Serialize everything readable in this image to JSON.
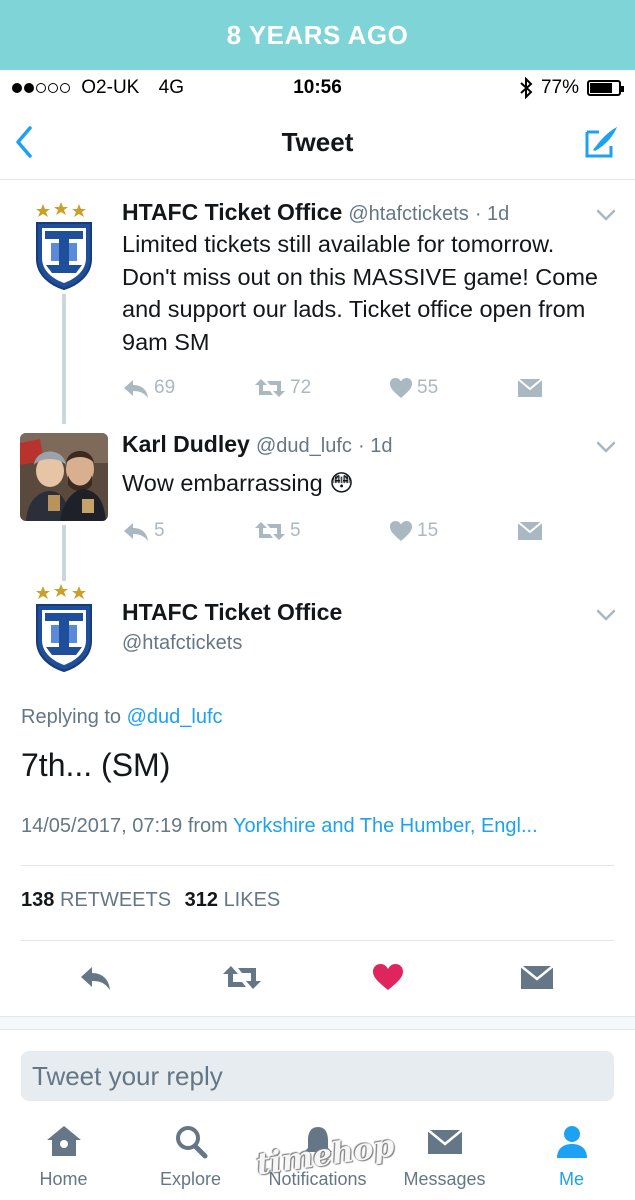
{
  "banner": {
    "text": "8 YEARS AGO"
  },
  "status_bar": {
    "carrier": "O2-UK",
    "network": "4G",
    "time": "10:56",
    "battery": "77%"
  },
  "nav": {
    "title": "Tweet",
    "back_icon": "chevron-left-icon",
    "compose_icon": "compose-icon"
  },
  "tweets": [
    {
      "name": "HTAFC Ticket Office",
      "handle": "@htafctickets",
      "age": "· 1d",
      "text": "Limited tickets still available for tomorrow. Don't miss out on this MASSIVE game! Come and support our lads. Ticket office open from 9am SM",
      "replies": "69",
      "retweets": "72",
      "likes": "55"
    },
    {
      "name": "Karl Dudley",
      "handle": "@dud_lufc",
      "age": "· 1d",
      "text": "Wow embarrassing 😳",
      "replies": "5",
      "retweets": "5",
      "likes": "15"
    }
  ],
  "main_tweet": {
    "name": "HTAFC Ticket Office",
    "handle": "@htafctickets",
    "replying_prefix": "Replying to",
    "replying_handle": "@dud_lufc",
    "text": "7th... (SM)",
    "timestamp": "14/05/2017, 07:19 from",
    "location": "Yorkshire and The Humber, Engl...",
    "retweets_count": "138",
    "retweets_label": "RETWEETS",
    "likes_count": "312",
    "likes_label": "LIKES"
  },
  "reply": {
    "placeholder": "Tweet your reply"
  },
  "tabs": [
    {
      "label": "Home",
      "icon": "home-icon"
    },
    {
      "label": "Explore",
      "icon": "search-icon"
    },
    {
      "label": "Notifications",
      "icon": "bell-icon"
    },
    {
      "label": "Messages",
      "icon": "envelope-icon"
    },
    {
      "label": "Me",
      "icon": "person-icon"
    }
  ],
  "watermark": "timehop",
  "colors": {
    "banner": "#7fd4d8",
    "accent": "#1da1f2",
    "like": "#e0245e",
    "muted": "#aab8c2"
  }
}
